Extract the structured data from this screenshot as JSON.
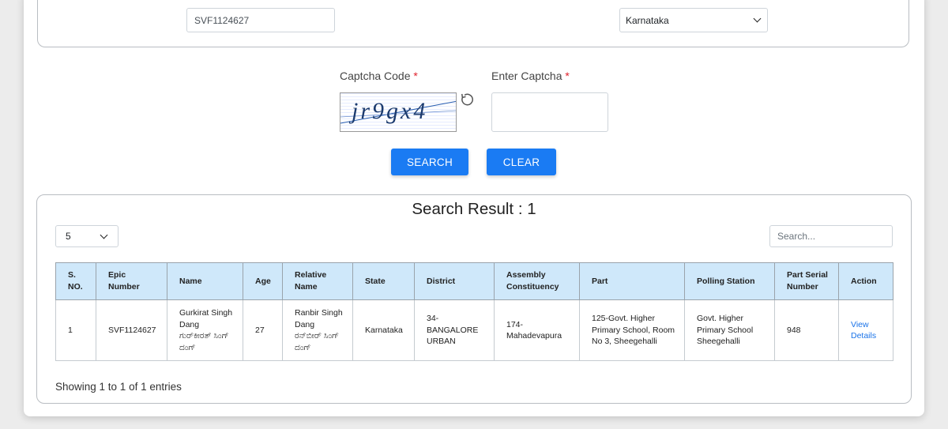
{
  "form": {
    "epic_value": "SVF1124627",
    "state_selected": "Karnataka",
    "captcha_label": "Captcha Code",
    "enter_captcha_label": "Enter Captcha",
    "required_mark": "*",
    "captcha_text": "jr9gx4",
    "search_label": "SEARCH",
    "clear_label": "CLEAR"
  },
  "results": {
    "title": "Search Result : 1",
    "page_length": "5",
    "search_placeholder": "Search...",
    "columns": [
      "S. NO.",
      "Epic Number",
      "Name",
      "Age",
      "Relative Name",
      "State",
      "District",
      "Assembly Constituency",
      "Part",
      "Polling Station",
      "Part Serial Number",
      "Action"
    ],
    "rows": [
      {
        "sno": "1",
        "epic": "SVF1124627",
        "name": "Gurkirat Singh Dang",
        "name_local": "ಗುರ್‌ಕೀರತ್ ಸಿಂಗ್ ದಂಗ್",
        "age": "27",
        "relative_name": "Ranbir Singh Dang",
        "relative_name_local": "ರನ್‌ಬೀರ್ ಸಿಂಗ್ ದಂಗ್",
        "state": "Karnataka",
        "district": "34-BANGALORE URBAN",
        "assembly": "174-Mahadevapura",
        "part": "125-Govt. Higher Primary School, Room No 3, Sheegehalli",
        "polling_station": "Govt. Higher Primary School Sheegehalli",
        "part_serial": "948",
        "action": "View Details"
      }
    ],
    "info": "Showing 1 to 1 of 1 entries"
  },
  "colors": {
    "primary": "#1a7bf3",
    "header_bg": "#cfe8fa",
    "link": "#1a73e8",
    "required": "#e0202b"
  },
  "icons": [
    "refresh-icon",
    "chevron-down-icon"
  ]
}
